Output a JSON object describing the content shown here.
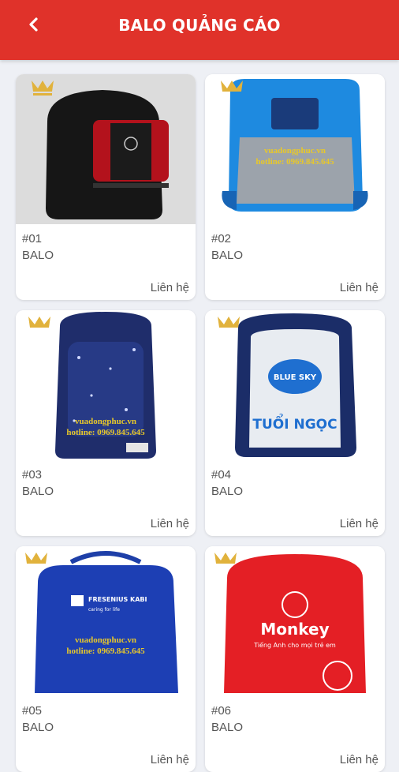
{
  "header": {
    "title": "BALO QUẢNG CÁO",
    "back_icon": "chevron-left-icon",
    "bg_color": "#e0322a"
  },
  "products": [
    {
      "code": "#01",
      "name": "BALO",
      "contact": "Liên hệ",
      "image": "black-red-backpack"
    },
    {
      "code": "#02",
      "name": "BALO",
      "contact": "Liên hệ",
      "image": "blue-grey-backpack",
      "brand_line1": "vuadongphuc.vn",
      "brand_line2": "hotline: 0969.845.645"
    },
    {
      "code": "#03",
      "name": "BALO",
      "contact": "Liên hệ",
      "image": "navy-galaxy-backpack",
      "brand_line1": "vuadongphuc.vn",
      "brand_line2": "hotline: 0969.845.645"
    },
    {
      "code": "#04",
      "name": "BALO",
      "contact": "Liên hệ",
      "image": "navy-white-backpack",
      "print_text": "TUỔI NGỌC",
      "logo_text": "BLUE SKY"
    },
    {
      "code": "#05",
      "name": "BALO",
      "contact": "Liên hệ",
      "image": "blue-messenger-backpack",
      "logo_text": "FRESENIUS KABI",
      "tagline": "caring for life",
      "brand_line1": "vuadongphuc.vn",
      "brand_line2": "hotline: 0969.845.645"
    },
    {
      "code": "#06",
      "name": "BALO",
      "contact": "Liên hệ",
      "image": "red-monkey-backpack",
      "logo_text": "Monkey",
      "tagline": "Tiếng Anh cho mọi trẻ em"
    }
  ]
}
